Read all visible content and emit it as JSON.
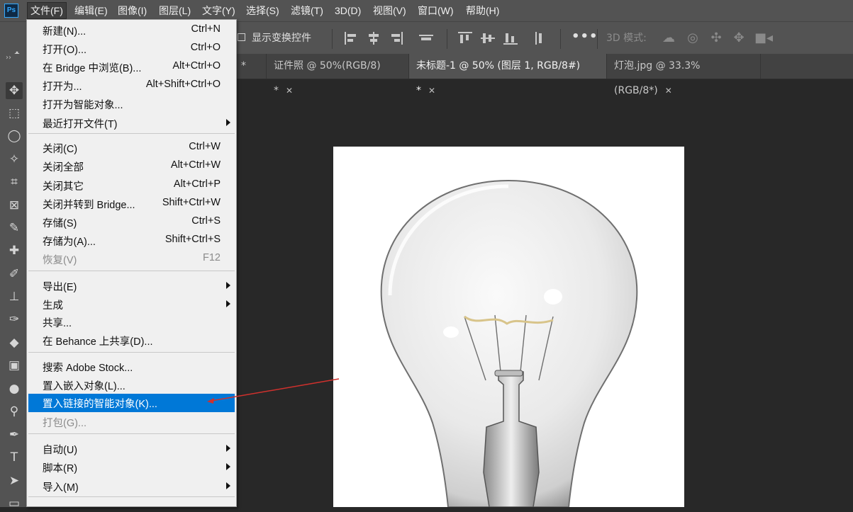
{
  "app": {
    "logo": "Ps"
  },
  "menubar": [
    {
      "id": "file",
      "label": "文件(F)"
    },
    {
      "id": "edit",
      "label": "编辑(E)"
    },
    {
      "id": "image",
      "label": "图像(I)"
    },
    {
      "id": "layer",
      "label": "图层(L)"
    },
    {
      "id": "type",
      "label": "文字(Y)"
    },
    {
      "id": "select",
      "label": "选择(S)"
    },
    {
      "id": "filter",
      "label": "滤镜(T)"
    },
    {
      "id": "3d",
      "label": "3D(D)"
    },
    {
      "id": "view",
      "label": "视图(V)"
    },
    {
      "id": "window",
      "label": "窗口(W)"
    },
    {
      "id": "help",
      "label": "帮助(H)"
    }
  ],
  "options": {
    "show_transform_label": "显示变换控件",
    "more": "•••",
    "mode_3d_label": "3D 模式:"
  },
  "tabs": [
    {
      "label": "*",
      "close": "✕"
    },
    {
      "label": "证件照 @ 50%(RGB/8) *",
      "close": "✕"
    },
    {
      "label": "未标题-1 @ 50% (图层 1, RGB/8#) *",
      "close": "✕",
      "active": true
    },
    {
      "label": "灯泡.jpg @ 33.3%(RGB/8*)",
      "close": "✕"
    }
  ],
  "file_menu": {
    "groups": [
      [
        {
          "label": "新建(N)...",
          "shortcut": "Ctrl+N"
        },
        {
          "label": "打开(O)...",
          "shortcut": "Ctrl+O"
        },
        {
          "label": "在 Bridge 中浏览(B)...",
          "shortcut": "Alt+Ctrl+O"
        },
        {
          "label": "打开为...",
          "shortcut": "Alt+Shift+Ctrl+O"
        },
        {
          "label": "打开为智能对象...",
          "shortcut": ""
        },
        {
          "label": "最近打开文件(T)",
          "shortcut": "",
          "submenu": true
        }
      ],
      [
        {
          "label": "关闭(C)",
          "shortcut": "Ctrl+W"
        },
        {
          "label": "关闭全部",
          "shortcut": "Alt+Ctrl+W"
        },
        {
          "label": "关闭其它",
          "shortcut": "Alt+Ctrl+P"
        },
        {
          "label": "关闭并转到 Bridge...",
          "shortcut": "Shift+Ctrl+W"
        },
        {
          "label": "存储(S)",
          "shortcut": "Ctrl+S"
        },
        {
          "label": "存储为(A)...",
          "shortcut": "Shift+Ctrl+S"
        },
        {
          "label": "恢复(V)",
          "shortcut": "F12",
          "disabled": true
        }
      ],
      [
        {
          "label": "导出(E)",
          "shortcut": "",
          "submenu": true
        },
        {
          "label": "生成",
          "shortcut": "",
          "submenu": true
        },
        {
          "label": "共享...",
          "shortcut": ""
        },
        {
          "label": "在 Behance 上共享(D)...",
          "shortcut": ""
        }
      ],
      [
        {
          "label": "搜索 Adobe Stock...",
          "shortcut": ""
        },
        {
          "label": "置入嵌入对象(L)...",
          "shortcut": ""
        },
        {
          "label": "置入链接的智能对象(K)...",
          "shortcut": "",
          "highlighted": true
        },
        {
          "label": "打包(G)...",
          "shortcut": "",
          "disabled": true
        }
      ],
      [
        {
          "label": "自动(U)",
          "shortcut": "",
          "submenu": true
        },
        {
          "label": "脚本(R)",
          "shortcut": "",
          "submenu": true
        },
        {
          "label": "导入(M)",
          "shortcut": "",
          "submenu": true
        }
      ]
    ]
  },
  "colors": {
    "highlight": "#0078d7",
    "annotation_arrow": "#d0312d"
  }
}
